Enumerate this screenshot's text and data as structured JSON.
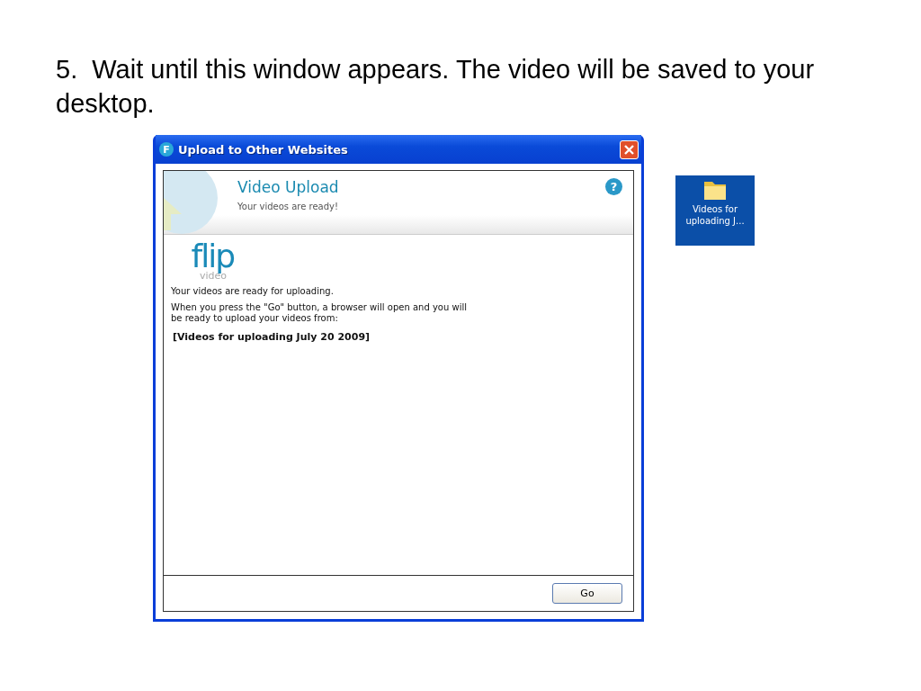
{
  "heading": "5.  Wait until this window appears. The video will be saved to your desktop.",
  "window": {
    "title": "Upload to Other Websites",
    "app_icon_letter": "F"
  },
  "header": {
    "title": "Video Upload",
    "subtitle": "Your videos are ready!",
    "help": "?"
  },
  "logo": {
    "word": "flip",
    "sub": "video"
  },
  "body": [
    "Your videos are ready for uploading.",
    "When you press the \"Go\" button, a browser will open and you will be ready to upload your videos from:"
  ],
  "folder_name": "[Videos for uploading July 20 2009]",
  "buttons": [
    "Go"
  ],
  "desktop_icon": {
    "label": "Videos for uploading J...",
    "selected": true
  }
}
